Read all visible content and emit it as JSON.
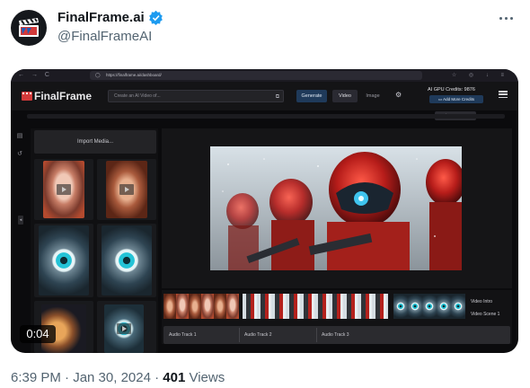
{
  "tweet": {
    "author_name": "FinalFrame.ai",
    "author_handle": "@FinalFrameAI",
    "timestamp": "6:39 PM · Jan 30, 2024 · ",
    "views_count": "401",
    "views_label": " Views",
    "verified_icon": "verified-badge-icon",
    "more_icon": "more-options-icon"
  },
  "video": {
    "duration": "0:04"
  },
  "browser": {
    "url": "https://finalframe.ai/dashboard/",
    "nav": "← → C"
  },
  "app": {
    "logo_text": "FinalFrame",
    "prompt_placeholder": "Create an AI Video of...",
    "generate_label": "Generate",
    "video_label": "Video",
    "image_label": "Image",
    "credits_label": "AI GPU Credits: 9876",
    "add_credits_label": "Add More Credits",
    "view_queue_label": "View Queue...",
    "import_media_label": "Import Media...",
    "timeline_tracks": [
      "Video Intro",
      "Video Scene 1"
    ],
    "audio_tracks": [
      "Audio Track 1",
      "Audio Track 2",
      "Audio Track 3"
    ]
  },
  "colors": {
    "brand_red": "#d33a3a",
    "accent_blue": "#1f3a5a",
    "verified_blue": "#1d9bf0"
  }
}
